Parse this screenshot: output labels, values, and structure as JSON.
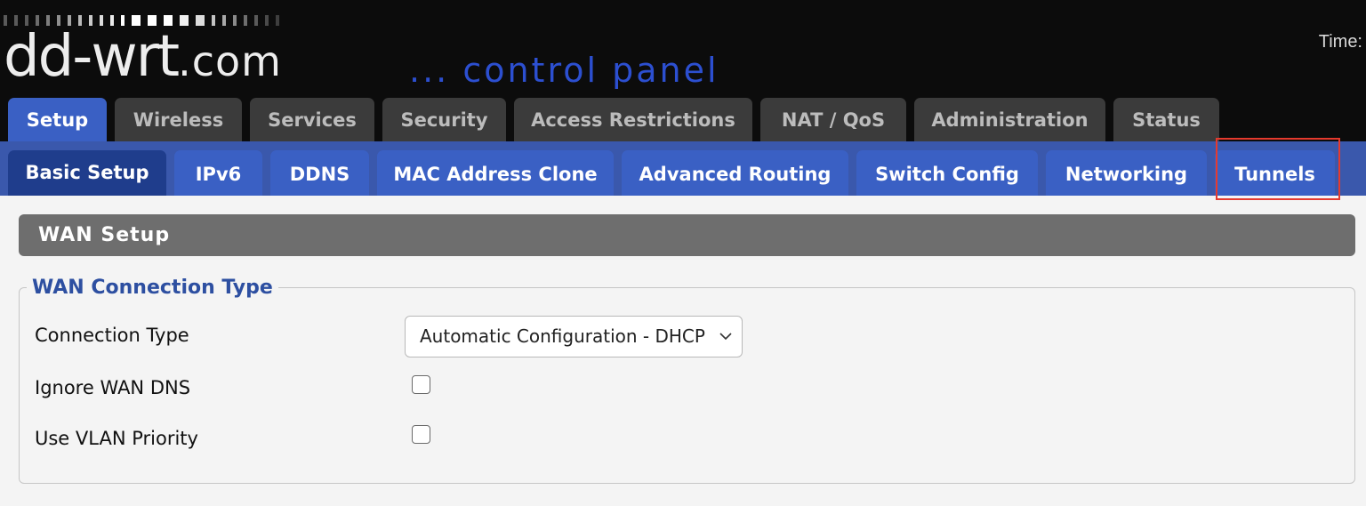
{
  "header": {
    "logo_text": "dd-wrt",
    "logo_suffix": ".com",
    "subtitle": "... control panel",
    "time_label": "Time:",
    "colors": {
      "background": "#0c0c0c",
      "accent": "#2c4fd0"
    }
  },
  "main_tabs": [
    {
      "label": "Setup",
      "active": true
    },
    {
      "label": "Wireless"
    },
    {
      "label": "Services"
    },
    {
      "label": "Security"
    },
    {
      "label": "Access Restrictions"
    },
    {
      "label": "NAT / QoS"
    },
    {
      "label": "Administration"
    },
    {
      "label": "Status"
    }
  ],
  "sub_tabs": [
    {
      "label": "Basic Setup",
      "active": true
    },
    {
      "label": "IPv6"
    },
    {
      "label": "DDNS"
    },
    {
      "label": "MAC Address Clone"
    },
    {
      "label": "Advanced Routing"
    },
    {
      "label": "Switch Config"
    },
    {
      "label": "Networking"
    },
    {
      "label": "Tunnels",
      "highlighted": true
    }
  ],
  "section": {
    "title": "WAN Setup",
    "fieldset_legend": "WAN Connection Type",
    "connection_type": {
      "label": "Connection Type",
      "value": "Automatic Configuration - DHCP"
    },
    "ignore_wan_dns": {
      "label": "Ignore WAN DNS",
      "checked": false
    },
    "use_vlan_priority": {
      "label": "Use VLAN Priority",
      "checked": false
    }
  },
  "colors": {
    "tab_active": "#3a60c4",
    "tab_inactive": "#3b3b3b",
    "sub_bar": "#3a58ac",
    "highlight": "#e53a2e",
    "section_header": "#6e6e6e",
    "legend_text": "#2d4fa1"
  }
}
